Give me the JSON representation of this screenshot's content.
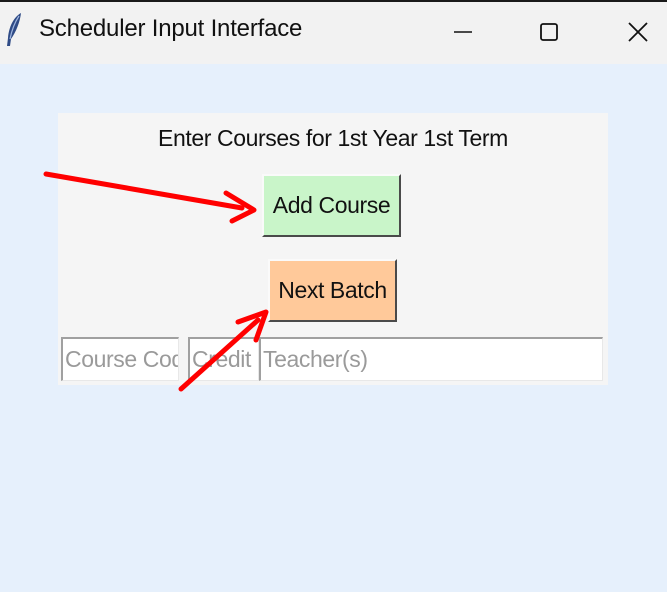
{
  "window": {
    "title": "Scheduler Input Interface",
    "icon": "feather-icon",
    "controls": {
      "minimize": "minimize-icon",
      "maximize": "maximize-icon",
      "close": "close-icon"
    }
  },
  "form": {
    "heading": "Enter Courses for 1st Year 1st Term",
    "add_course_label": "Add Course",
    "next_batch_label": "Next Batch",
    "fields": {
      "course_code": {
        "placeholder": "Course Code",
        "value": ""
      },
      "credit": {
        "placeholder": "Credit",
        "value": ""
      },
      "teachers": {
        "placeholder": "Teacher(s)",
        "value": ""
      }
    }
  },
  "colors": {
    "background": "#e6f0fc",
    "frame": "#f5f5f5",
    "add_button": "#c9f5c9",
    "next_button": "#ffc99a",
    "annotation_arrow": "#ff0000"
  }
}
